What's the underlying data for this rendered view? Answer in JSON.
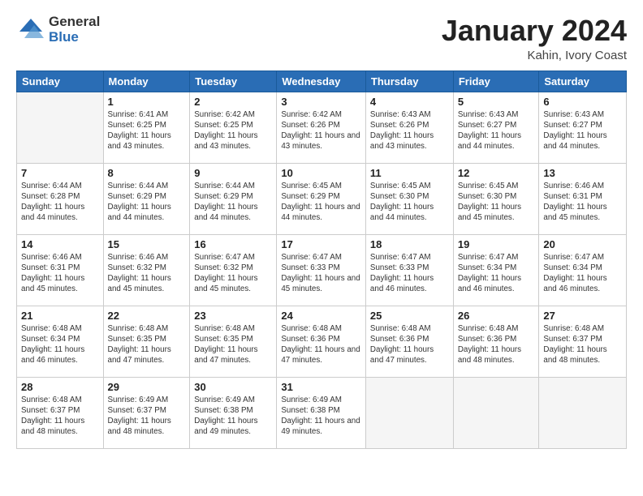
{
  "logo": {
    "general": "General",
    "blue": "Blue"
  },
  "title": {
    "month": "January 2024",
    "location": "Kahin, Ivory Coast"
  },
  "days_of_week": [
    "Sunday",
    "Monday",
    "Tuesday",
    "Wednesday",
    "Thursday",
    "Friday",
    "Saturday"
  ],
  "weeks": [
    [
      {
        "day": "",
        "sunrise": "",
        "sunset": "",
        "daylight": "",
        "empty": true
      },
      {
        "day": "1",
        "sunrise": "Sunrise: 6:41 AM",
        "sunset": "Sunset: 6:25 PM",
        "daylight": "Daylight: 11 hours and 43 minutes."
      },
      {
        "day": "2",
        "sunrise": "Sunrise: 6:42 AM",
        "sunset": "Sunset: 6:25 PM",
        "daylight": "Daylight: 11 hours and 43 minutes."
      },
      {
        "day": "3",
        "sunrise": "Sunrise: 6:42 AM",
        "sunset": "Sunset: 6:26 PM",
        "daylight": "Daylight: 11 hours and 43 minutes."
      },
      {
        "day": "4",
        "sunrise": "Sunrise: 6:43 AM",
        "sunset": "Sunset: 6:26 PM",
        "daylight": "Daylight: 11 hours and 43 minutes."
      },
      {
        "day": "5",
        "sunrise": "Sunrise: 6:43 AM",
        "sunset": "Sunset: 6:27 PM",
        "daylight": "Daylight: 11 hours and 44 minutes."
      },
      {
        "day": "6",
        "sunrise": "Sunrise: 6:43 AM",
        "sunset": "Sunset: 6:27 PM",
        "daylight": "Daylight: 11 hours and 44 minutes."
      }
    ],
    [
      {
        "day": "7",
        "sunrise": "Sunrise: 6:44 AM",
        "sunset": "Sunset: 6:28 PM",
        "daylight": "Daylight: 11 hours and 44 minutes."
      },
      {
        "day": "8",
        "sunrise": "Sunrise: 6:44 AM",
        "sunset": "Sunset: 6:29 PM",
        "daylight": "Daylight: 11 hours and 44 minutes."
      },
      {
        "day": "9",
        "sunrise": "Sunrise: 6:44 AM",
        "sunset": "Sunset: 6:29 PM",
        "daylight": "Daylight: 11 hours and 44 minutes."
      },
      {
        "day": "10",
        "sunrise": "Sunrise: 6:45 AM",
        "sunset": "Sunset: 6:29 PM",
        "daylight": "Daylight: 11 hours and 44 minutes."
      },
      {
        "day": "11",
        "sunrise": "Sunrise: 6:45 AM",
        "sunset": "Sunset: 6:30 PM",
        "daylight": "Daylight: 11 hours and 44 minutes."
      },
      {
        "day": "12",
        "sunrise": "Sunrise: 6:45 AM",
        "sunset": "Sunset: 6:30 PM",
        "daylight": "Daylight: 11 hours and 45 minutes."
      },
      {
        "day": "13",
        "sunrise": "Sunrise: 6:46 AM",
        "sunset": "Sunset: 6:31 PM",
        "daylight": "Daylight: 11 hours and 45 minutes."
      }
    ],
    [
      {
        "day": "14",
        "sunrise": "Sunrise: 6:46 AM",
        "sunset": "Sunset: 6:31 PM",
        "daylight": "Daylight: 11 hours and 45 minutes."
      },
      {
        "day": "15",
        "sunrise": "Sunrise: 6:46 AM",
        "sunset": "Sunset: 6:32 PM",
        "daylight": "Daylight: 11 hours and 45 minutes."
      },
      {
        "day": "16",
        "sunrise": "Sunrise: 6:47 AM",
        "sunset": "Sunset: 6:32 PM",
        "daylight": "Daylight: 11 hours and 45 minutes."
      },
      {
        "day": "17",
        "sunrise": "Sunrise: 6:47 AM",
        "sunset": "Sunset: 6:33 PM",
        "daylight": "Daylight: 11 hours and 45 minutes."
      },
      {
        "day": "18",
        "sunrise": "Sunrise: 6:47 AM",
        "sunset": "Sunset: 6:33 PM",
        "daylight": "Daylight: 11 hours and 46 minutes."
      },
      {
        "day": "19",
        "sunrise": "Sunrise: 6:47 AM",
        "sunset": "Sunset: 6:34 PM",
        "daylight": "Daylight: 11 hours and 46 minutes."
      },
      {
        "day": "20",
        "sunrise": "Sunrise: 6:47 AM",
        "sunset": "Sunset: 6:34 PM",
        "daylight": "Daylight: 11 hours and 46 minutes."
      }
    ],
    [
      {
        "day": "21",
        "sunrise": "Sunrise: 6:48 AM",
        "sunset": "Sunset: 6:34 PM",
        "daylight": "Daylight: 11 hours and 46 minutes."
      },
      {
        "day": "22",
        "sunrise": "Sunrise: 6:48 AM",
        "sunset": "Sunset: 6:35 PM",
        "daylight": "Daylight: 11 hours and 47 minutes."
      },
      {
        "day": "23",
        "sunrise": "Sunrise: 6:48 AM",
        "sunset": "Sunset: 6:35 PM",
        "daylight": "Daylight: 11 hours and 47 minutes."
      },
      {
        "day": "24",
        "sunrise": "Sunrise: 6:48 AM",
        "sunset": "Sunset: 6:36 PM",
        "daylight": "Daylight: 11 hours and 47 minutes."
      },
      {
        "day": "25",
        "sunrise": "Sunrise: 6:48 AM",
        "sunset": "Sunset: 6:36 PM",
        "daylight": "Daylight: 11 hours and 47 minutes."
      },
      {
        "day": "26",
        "sunrise": "Sunrise: 6:48 AM",
        "sunset": "Sunset: 6:36 PM",
        "daylight": "Daylight: 11 hours and 48 minutes."
      },
      {
        "day": "27",
        "sunrise": "Sunrise: 6:48 AM",
        "sunset": "Sunset: 6:37 PM",
        "daylight": "Daylight: 11 hours and 48 minutes."
      }
    ],
    [
      {
        "day": "28",
        "sunrise": "Sunrise: 6:48 AM",
        "sunset": "Sunset: 6:37 PM",
        "daylight": "Daylight: 11 hours and 48 minutes."
      },
      {
        "day": "29",
        "sunrise": "Sunrise: 6:49 AM",
        "sunset": "Sunset: 6:37 PM",
        "daylight": "Daylight: 11 hours and 48 minutes."
      },
      {
        "day": "30",
        "sunrise": "Sunrise: 6:49 AM",
        "sunset": "Sunset: 6:38 PM",
        "daylight": "Daylight: 11 hours and 49 minutes."
      },
      {
        "day": "31",
        "sunrise": "Sunrise: 6:49 AM",
        "sunset": "Sunset: 6:38 PM",
        "daylight": "Daylight: 11 hours and 49 minutes."
      },
      {
        "day": "",
        "sunrise": "",
        "sunset": "",
        "daylight": "",
        "empty": true
      },
      {
        "day": "",
        "sunrise": "",
        "sunset": "",
        "daylight": "",
        "empty": true
      },
      {
        "day": "",
        "sunrise": "",
        "sunset": "",
        "daylight": "",
        "empty": true
      }
    ]
  ]
}
